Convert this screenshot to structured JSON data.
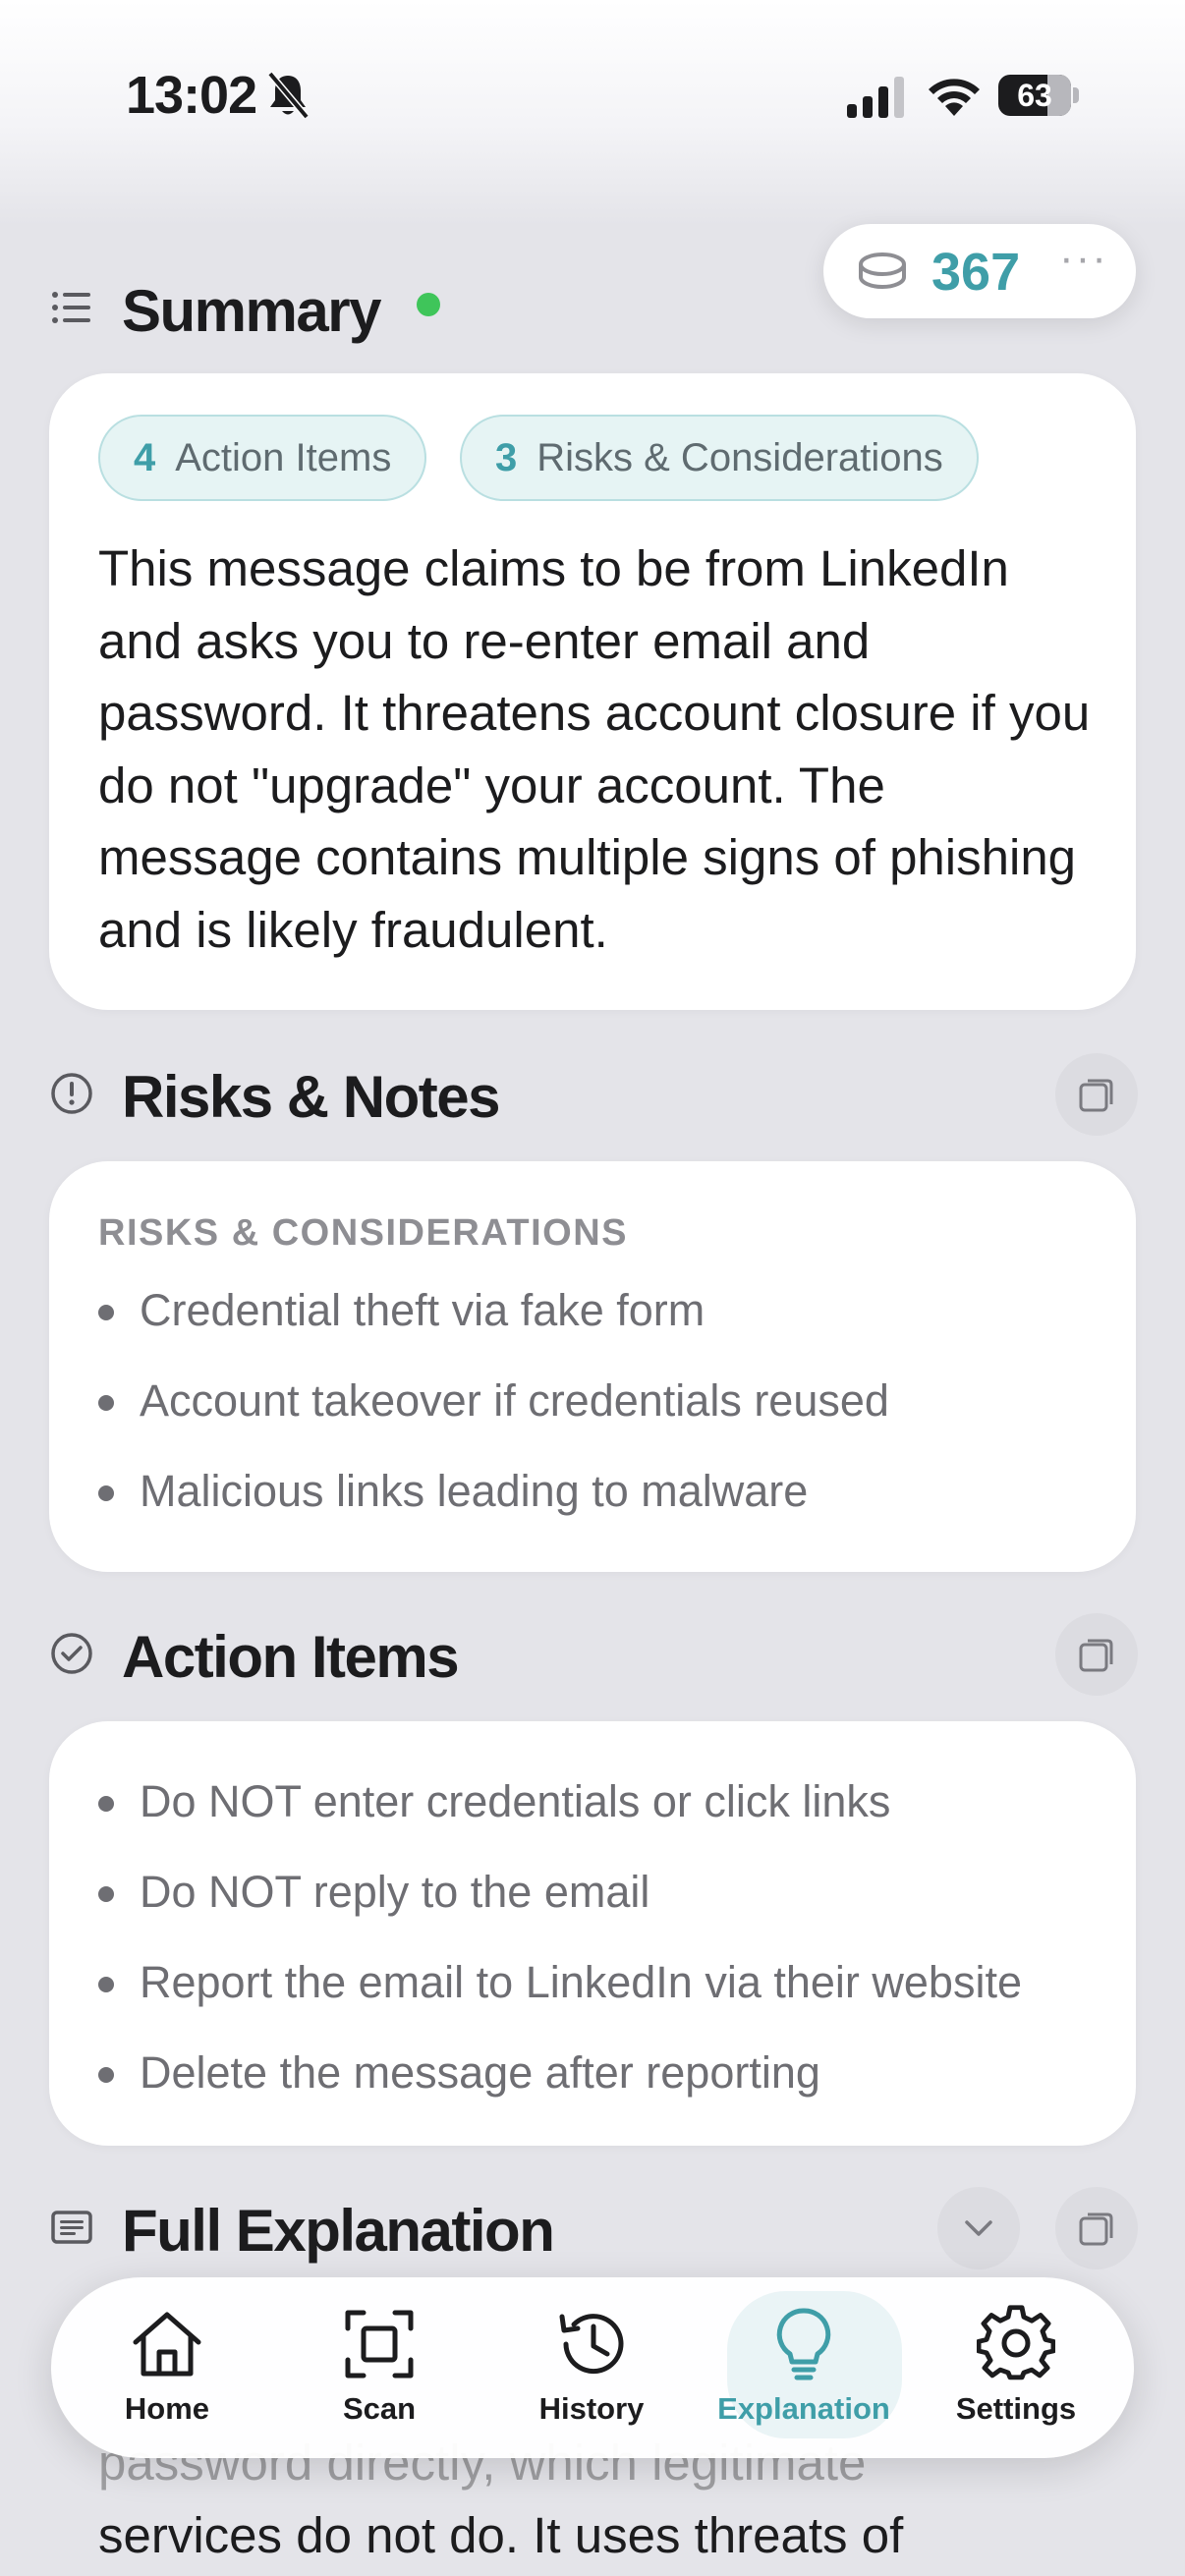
{
  "status_bar": {
    "time": "13:02",
    "battery": "63"
  },
  "coins": {
    "value": "367",
    "more": "···"
  },
  "summary": {
    "title": "Summary",
    "chips": [
      {
        "count": "4",
        "label": "Action Items"
      },
      {
        "count": "3",
        "label": "Risks & Considerations"
      }
    ],
    "text": "This message claims to be from LinkedIn and asks you to re-enter email and password. It threatens account closure if you do not \"upgrade\" your account. The message contains multiple signs of phishing and is likely fraudulent."
  },
  "risks": {
    "title": "Risks & Notes",
    "label": "RISKS & CONSIDERATIONS",
    "items": [
      "Credential theft via fake form",
      "Account takeover if credentials reused",
      "Malicious links leading to malware"
    ]
  },
  "actions": {
    "title": "Action Items",
    "items": [
      "Do NOT enter credentials or click links",
      "Do NOT reply to the email",
      "Report the email to LinkedIn via their website",
      "Delete the message after reporting"
    ]
  },
  "explanation": {
    "title": "Full Explanation",
    "line_hidden": "password directly, which legitimate",
    "line_visible": "services do not do. It uses threats of"
  },
  "tabbar": {
    "items": [
      {
        "label": "Home"
      },
      {
        "label": "Scan"
      },
      {
        "label": "History"
      },
      {
        "label": "Explanation",
        "active": true
      },
      {
        "label": "Settings"
      }
    ],
    "accent": "#3f9ea8"
  }
}
